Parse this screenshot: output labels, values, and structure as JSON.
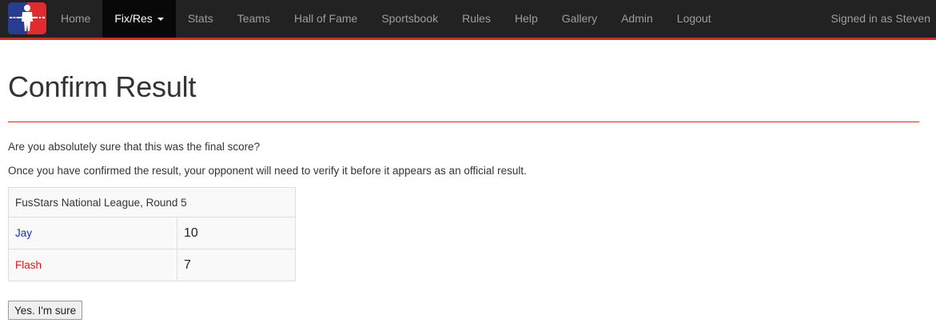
{
  "nav": {
    "logo_icon": "foosball-player-logo",
    "items": [
      {
        "label": "Home"
      },
      {
        "label": "Fix/Res",
        "active": true
      },
      {
        "label": "Stats"
      },
      {
        "label": "Teams"
      },
      {
        "label": "Hall of Fame"
      },
      {
        "label": "Sportsbook"
      },
      {
        "label": "Rules"
      },
      {
        "label": "Help"
      },
      {
        "label": "Gallery"
      },
      {
        "label": "Admin"
      },
      {
        "label": "Logout"
      }
    ],
    "signed_in": "Signed in as Steven"
  },
  "page": {
    "title": "Confirm Result",
    "question": "Are you absolutely sure that this was the final score?",
    "note": "Once you have confirmed the result, your opponent will need to verify it before it appears as an official result."
  },
  "result": {
    "fixture": "FusStars National League, Round 5",
    "rows": [
      {
        "team": "Jay",
        "score": "10",
        "color": "#1a2bd1"
      },
      {
        "team": "Flash",
        "score": "7",
        "color": "#e0151f"
      }
    ]
  },
  "actions": {
    "confirm_label": "Yes. I'm sure"
  },
  "colors": {
    "accent": "#d9242a",
    "navbar": "#222222"
  }
}
